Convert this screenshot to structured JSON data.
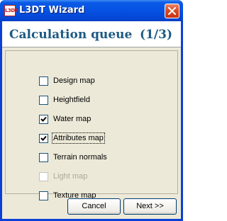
{
  "window": {
    "title": "L3DT Wizard",
    "app_icon_text": "L3DT",
    "title_bar_color": "#0552e3",
    "close_button_color": "#dc4a26"
  },
  "header": {
    "title": "Calculation queue",
    "step": "(1/3)",
    "text_color": "#1c5a83"
  },
  "options": [
    {
      "label": "Design map",
      "checked": false,
      "enabled": true,
      "focused": false
    },
    {
      "label": "Heightfield",
      "checked": false,
      "enabled": true,
      "focused": false
    },
    {
      "label": "Water map",
      "checked": true,
      "enabled": true,
      "focused": false
    },
    {
      "label": "Attributes map",
      "checked": true,
      "enabled": true,
      "focused": true
    },
    {
      "label": "Terrain normals",
      "checked": false,
      "enabled": true,
      "focused": false
    },
    {
      "label": "Light map",
      "checked": false,
      "enabled": false,
      "focused": false
    },
    {
      "label": "Texture map",
      "checked": false,
      "enabled": true,
      "focused": false
    }
  ],
  "buttons": {
    "cancel_label": "Cancel",
    "next_label": "Next >>"
  }
}
